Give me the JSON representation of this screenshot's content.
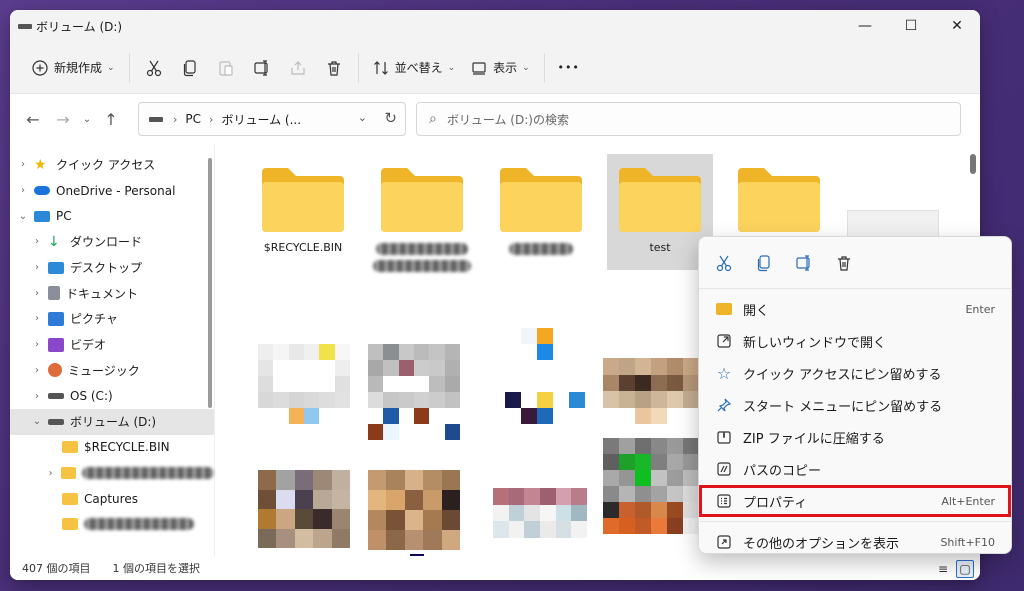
{
  "window": {
    "title": "ボリューム (D:)"
  },
  "titlebar": {
    "minimize": "—",
    "maximize": "☐",
    "close": "✕"
  },
  "toolbar": {
    "new_label": "新規作成",
    "sort_label": "並べ替え",
    "view_label": "表示",
    "more_label": "•••"
  },
  "address": {
    "segments": [
      "PC",
      "ボリューム (..."
    ],
    "search_placeholder": "ボリューム (D:)の検索"
  },
  "nav": {
    "items": [
      {
        "label": "クイック アクセス",
        "icon": "star-icon",
        "color": "#f2b600"
      },
      {
        "label": "OneDrive - Personal",
        "icon": "cloud-icon",
        "color": "#1a73d9"
      },
      {
        "label": "PC",
        "icon": "computer-icon",
        "color": "#2b88d8"
      },
      {
        "label": "ダウンロード",
        "icon": "download-icon",
        "color": "#1aa260"
      },
      {
        "label": "デスクトップ",
        "icon": "desktop-icon",
        "color": "#2d8ad6"
      },
      {
        "label": "ドキュメント",
        "icon": "document-icon",
        "color": "#8a8f99"
      },
      {
        "label": "ピクチャ",
        "icon": "pictures-icon",
        "color": "#2d7bd6"
      },
      {
        "label": "ビデオ",
        "icon": "video-icon",
        "color": "#8b47c9"
      },
      {
        "label": "ミュージック",
        "icon": "music-icon",
        "color": "#e06b3b"
      },
      {
        "label": "OS (C:)",
        "icon": "drive-icon",
        "color": "#555555"
      },
      {
        "label": "ボリューム (D:)",
        "icon": "drive-icon",
        "color": "#555555"
      },
      {
        "label": "$RECYCLE.BIN",
        "icon": "folder-icon",
        "color": "#f5c242"
      },
      {
        "label": "",
        "icon": "folder-icon",
        "color": "#f5c242"
      },
      {
        "label": "Captures",
        "icon": "folder-icon",
        "color": "#f5c242"
      },
      {
        "label": "",
        "icon": "folder-icon",
        "color": "#f5c242"
      }
    ]
  },
  "folders": [
    {
      "label": "$RECYCLE.BIN"
    },
    {
      "label": ""
    },
    {
      "label": ""
    },
    {
      "label": "test"
    },
    {
      "label": ""
    }
  ],
  "status": {
    "count": "407 個の項目",
    "selected": "1 個の項目を選択"
  },
  "context_menu": {
    "items": [
      {
        "label": "開く",
        "shortcut": "Enter",
        "icon": "open-folder-icon"
      },
      {
        "label": "新しいウィンドウで開く",
        "shortcut": "",
        "icon": "new-window-icon"
      },
      {
        "label": "クイック アクセスにピン留めする",
        "shortcut": "",
        "icon": "star-outline-icon"
      },
      {
        "label": "スタート メニューにピン留めする",
        "shortcut": "",
        "icon": "pin-icon"
      },
      {
        "label": "ZIP ファイルに圧縮する",
        "shortcut": "",
        "icon": "zip-icon"
      },
      {
        "label": "パスのコピー",
        "shortcut": "",
        "icon": "copy-path-icon"
      },
      {
        "label": "プロパティ",
        "shortcut": "Alt+Enter",
        "icon": "properties-icon"
      },
      {
        "label": "その他のオプションを表示",
        "shortcut": "Shift+F10",
        "icon": "more-options-icon"
      }
    ]
  },
  "colors": {
    "folder": "#f6c544",
    "folder_light": "#fbd870",
    "highlight_border": "#e0141b",
    "accent": "#2f6fd1"
  }
}
